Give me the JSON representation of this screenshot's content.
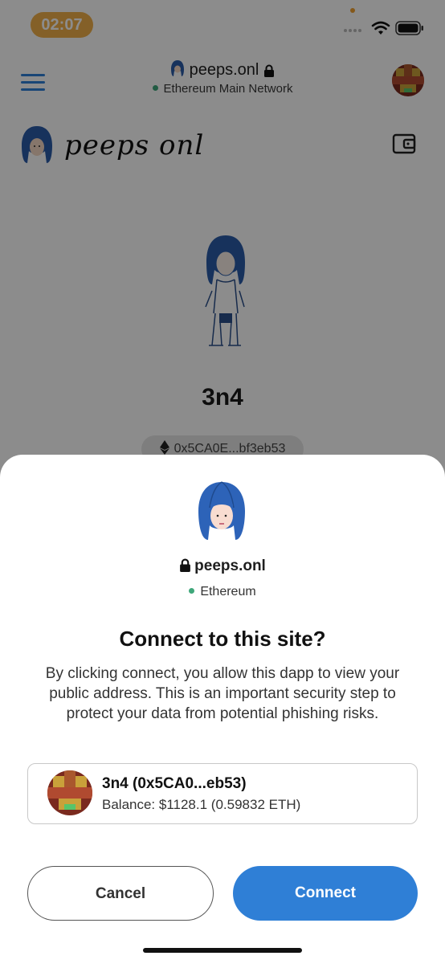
{
  "status_bar": {
    "time": "02:07"
  },
  "nav": {
    "site_name": "peeps.onl",
    "network": "Ethereum Main Network"
  },
  "site": {
    "logo_text": "peeps onl",
    "profile_name": "3n4",
    "address_short": "0x5CA0E...bf3eb53"
  },
  "connect_sheet": {
    "site_name": "peeps.onl",
    "network": "Ethereum",
    "title": "Connect to this site?",
    "description": "By clicking connect, you allow this dapp to view your public address. This is an important security step to protect your data from potential phishing risks.",
    "account": {
      "name": "3n4 (0x5CA0...eb53)",
      "balance": "Balance: $1128.1 (0.59832 ETH)"
    },
    "cancel_label": "Cancel",
    "connect_label": "Connect"
  },
  "colors": {
    "accent": "#2f7fd6",
    "network_dot": "#3fa77a",
    "time_pill": "#f0b04a"
  }
}
